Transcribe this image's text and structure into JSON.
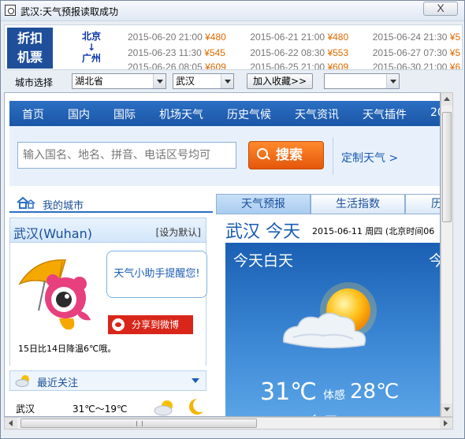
{
  "window": {
    "title": "武汉:天气预报读取成功",
    "close_label": "X"
  },
  "ticker": {
    "badge": "折扣机票",
    "route_from": "北京",
    "route_arrow": "↓",
    "route_to": "广州",
    "rows": [
      [
        {
          "date": "2015-06-20 21:00",
          "price": "¥480"
        },
        {
          "date": "2015-06-21 21:00",
          "price": "¥480"
        },
        {
          "date": "2015-06-24 21:30",
          "price": "¥5"
        }
      ],
      [
        {
          "date": "2015-06-23 11:30",
          "price": "¥545"
        },
        {
          "date": "2015-06-22 08:30",
          "price": "¥553"
        },
        {
          "date": "2015-06-27 07:30",
          "price": "¥5"
        }
      ],
      [
        {
          "date": "2015-06-26 08:05",
          "price": "¥609"
        },
        {
          "date": "2015-06-25 21:00",
          "price": "¥609"
        },
        {
          "date": "2015-06-30 21:00",
          "price": "¥6"
        }
      ]
    ]
  },
  "toolbar": {
    "city_label": "城市选择",
    "province": "湖北省",
    "city": "武汉",
    "fav_button": "加入收藏>>",
    "fav_select": ""
  },
  "nav": {
    "items": [
      "首页",
      "国内",
      "国际",
      "机场天气",
      "历史气候",
      "天气资讯",
      "天气插件",
      "20"
    ]
  },
  "search": {
    "placeholder": "输入国名、地名、拼音、电话区号均可",
    "button": "搜索",
    "custom_link": "定制天气 >"
  },
  "left": {
    "my_city": "我的城市",
    "city_name": "武汉(Wuhan)",
    "set_default": "[设为默认]",
    "bubble": "天气小助手提醒您!",
    "share": "分享到微博",
    "temp_note": "15日比14日降温6℃哦。",
    "recent_title": "最近关注",
    "recent": [
      {
        "city": "武汉",
        "temp": "31℃～19℃"
      }
    ]
  },
  "right": {
    "tabs": [
      "天气预报",
      "生活指数",
      "历"
    ],
    "headline": "武汉 今天",
    "date": "2015-06-11  周四  (北京时间06",
    "today_label": "今天白天",
    "today_label2": "今",
    "temperature": "31℃",
    "feels_label": "体感",
    "feels_value": "28℃",
    "condition": "多云"
  },
  "colors": {
    "nav_blue": "#1b56a6",
    "price_orange": "#e06a00",
    "search_orange": "#e4570a",
    "share_red": "#d8261a"
  }
}
